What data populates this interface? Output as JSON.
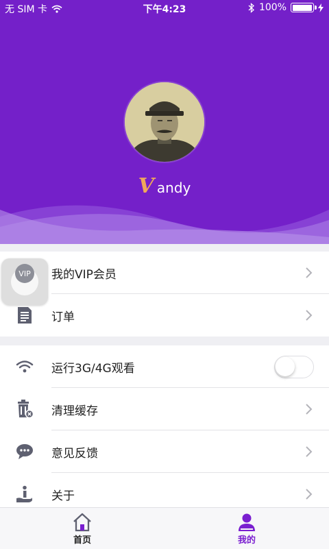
{
  "status_bar": {
    "carrier": "无 SIM 卡",
    "time": "下午4:23",
    "battery": "100%",
    "battery_level": 1.0
  },
  "profile": {
    "username": "andy",
    "logo_letter": "V"
  },
  "vip_overlay": {
    "badge": "VIP"
  },
  "menu_group1": [
    {
      "label": "我的VIP会员",
      "icon": "vip-icon"
    },
    {
      "label": "订单",
      "icon": "order-document-icon"
    }
  ],
  "menu_group2": [
    {
      "label": "运行3G/4G观看",
      "icon": "wifi-icon",
      "toggle_on": false
    },
    {
      "label": "清理缓存",
      "icon": "trash-icon"
    },
    {
      "label": "意见反馈",
      "icon": "chat-bubble-icon"
    },
    {
      "label": "关于",
      "icon": "info-hand-icon"
    }
  ],
  "tabs": [
    {
      "label": "首页",
      "icon": "home-icon",
      "active": false
    },
    {
      "label": "我的",
      "icon": "person-icon",
      "active": true
    }
  ],
  "colors": {
    "header_bg": "#7420c9",
    "accent_purple": "#7a1fd0",
    "icon_gray": "#5e6070",
    "text_dark": "#222222"
  }
}
